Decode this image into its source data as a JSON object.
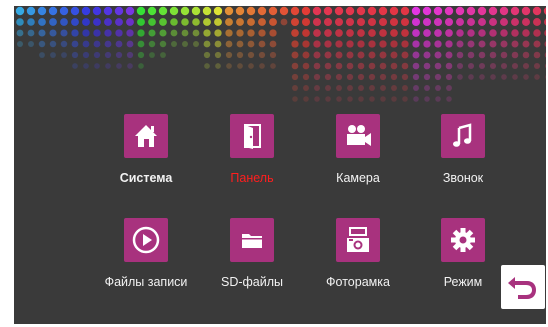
{
  "menu": {
    "items": [
      {
        "label": "Система",
        "icon": "home-icon",
        "state": "selected"
      },
      {
        "label": "Панель",
        "icon": "door-icon",
        "state": "active"
      },
      {
        "label": "Камера",
        "icon": "video-camera-icon",
        "state": "normal"
      },
      {
        "label": "Звонок",
        "icon": "music-note-icon",
        "state": "normal"
      },
      {
        "label": "Файлы записи",
        "icon": "play-icon",
        "state": "normal"
      },
      {
        "label": "SD-файлы",
        "icon": "folder-icon",
        "state": "normal"
      },
      {
        "label": "Фоторамка",
        "icon": "photo-frame-icon",
        "state": "normal"
      },
      {
        "label": "Режим",
        "icon": "gear-icon",
        "state": "normal"
      }
    ]
  },
  "back_button": {
    "icon": "back-arrow-icon"
  },
  "colors": {
    "screen_bg": "#3a3a3a",
    "tile": "#a8327e",
    "active_label": "#ff1e1e",
    "label": "#f2f2f2",
    "back_arrow": "#a8327e"
  }
}
